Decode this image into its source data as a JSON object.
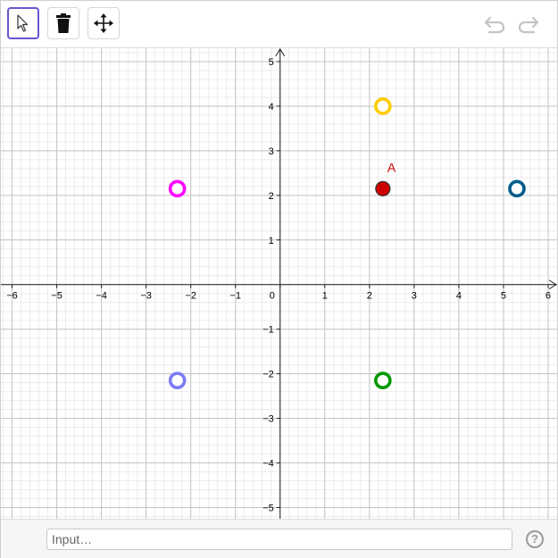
{
  "toolbar": {
    "tools": [
      {
        "name": "select-tool-button",
        "icon": "cursor-arrow-icon",
        "selected": true
      },
      {
        "name": "delete-tool-button",
        "icon": "trash-icon",
        "selected": false
      },
      {
        "name": "move-graphics-tool-button",
        "icon": "move-arrows-icon",
        "selected": false
      }
    ],
    "undo_icon": "undo-icon",
    "redo_icon": "redo-icon",
    "accent_color": "#6557d2"
  },
  "graph": {
    "x_range": [
      -6.25,
      6.2
    ],
    "y_range": [
      -5.25,
      5.3
    ],
    "x_ticks": [
      -6,
      -5,
      -4,
      -3,
      -2,
      -1,
      0,
      1,
      2,
      3,
      4,
      5,
      6
    ],
    "y_ticks": [
      -5,
      -4,
      -3,
      -2,
      -1,
      1,
      2,
      3,
      4,
      5
    ],
    "x_tick_labels": [
      "−6",
      "−5",
      "−4",
      "−3",
      "−2",
      "−1",
      "0",
      "1",
      "2",
      "3",
      "4",
      "5",
      "6"
    ],
    "y_tick_labels": [
      "−5",
      "−4",
      "−3",
      "−2",
      "−1",
      "1",
      "2",
      "3",
      "4",
      "5"
    ],
    "major_grid": true,
    "minor_grid": true,
    "minor_divisions": 5,
    "points": [
      {
        "name": "point-a",
        "label": "A",
        "x": 2.3,
        "y": 2.15,
        "style": "filled",
        "color": "#cc0000",
        "label_color": "#cc0000"
      },
      {
        "name": "point-yellow",
        "label": "",
        "x": 2.3,
        "y": 4.0,
        "style": "ring",
        "color": "#ffcc00"
      },
      {
        "name": "point-magenta",
        "label": "",
        "x": -2.3,
        "y": 2.15,
        "style": "ring",
        "color": "#ff00ff"
      },
      {
        "name": "point-teal",
        "label": "",
        "x": 5.3,
        "y": 2.15,
        "style": "ring",
        "color": "#005c8a"
      },
      {
        "name": "point-lavender",
        "label": "",
        "x": -2.3,
        "y": -2.15,
        "style": "ring",
        "color": "#7b7bf2"
      },
      {
        "name": "point-green",
        "label": "",
        "x": 2.3,
        "y": -2.15,
        "style": "ring",
        "color": "#009900"
      }
    ]
  },
  "input": {
    "placeholder": "Input…",
    "value": ""
  },
  "help": {
    "label": "?"
  }
}
